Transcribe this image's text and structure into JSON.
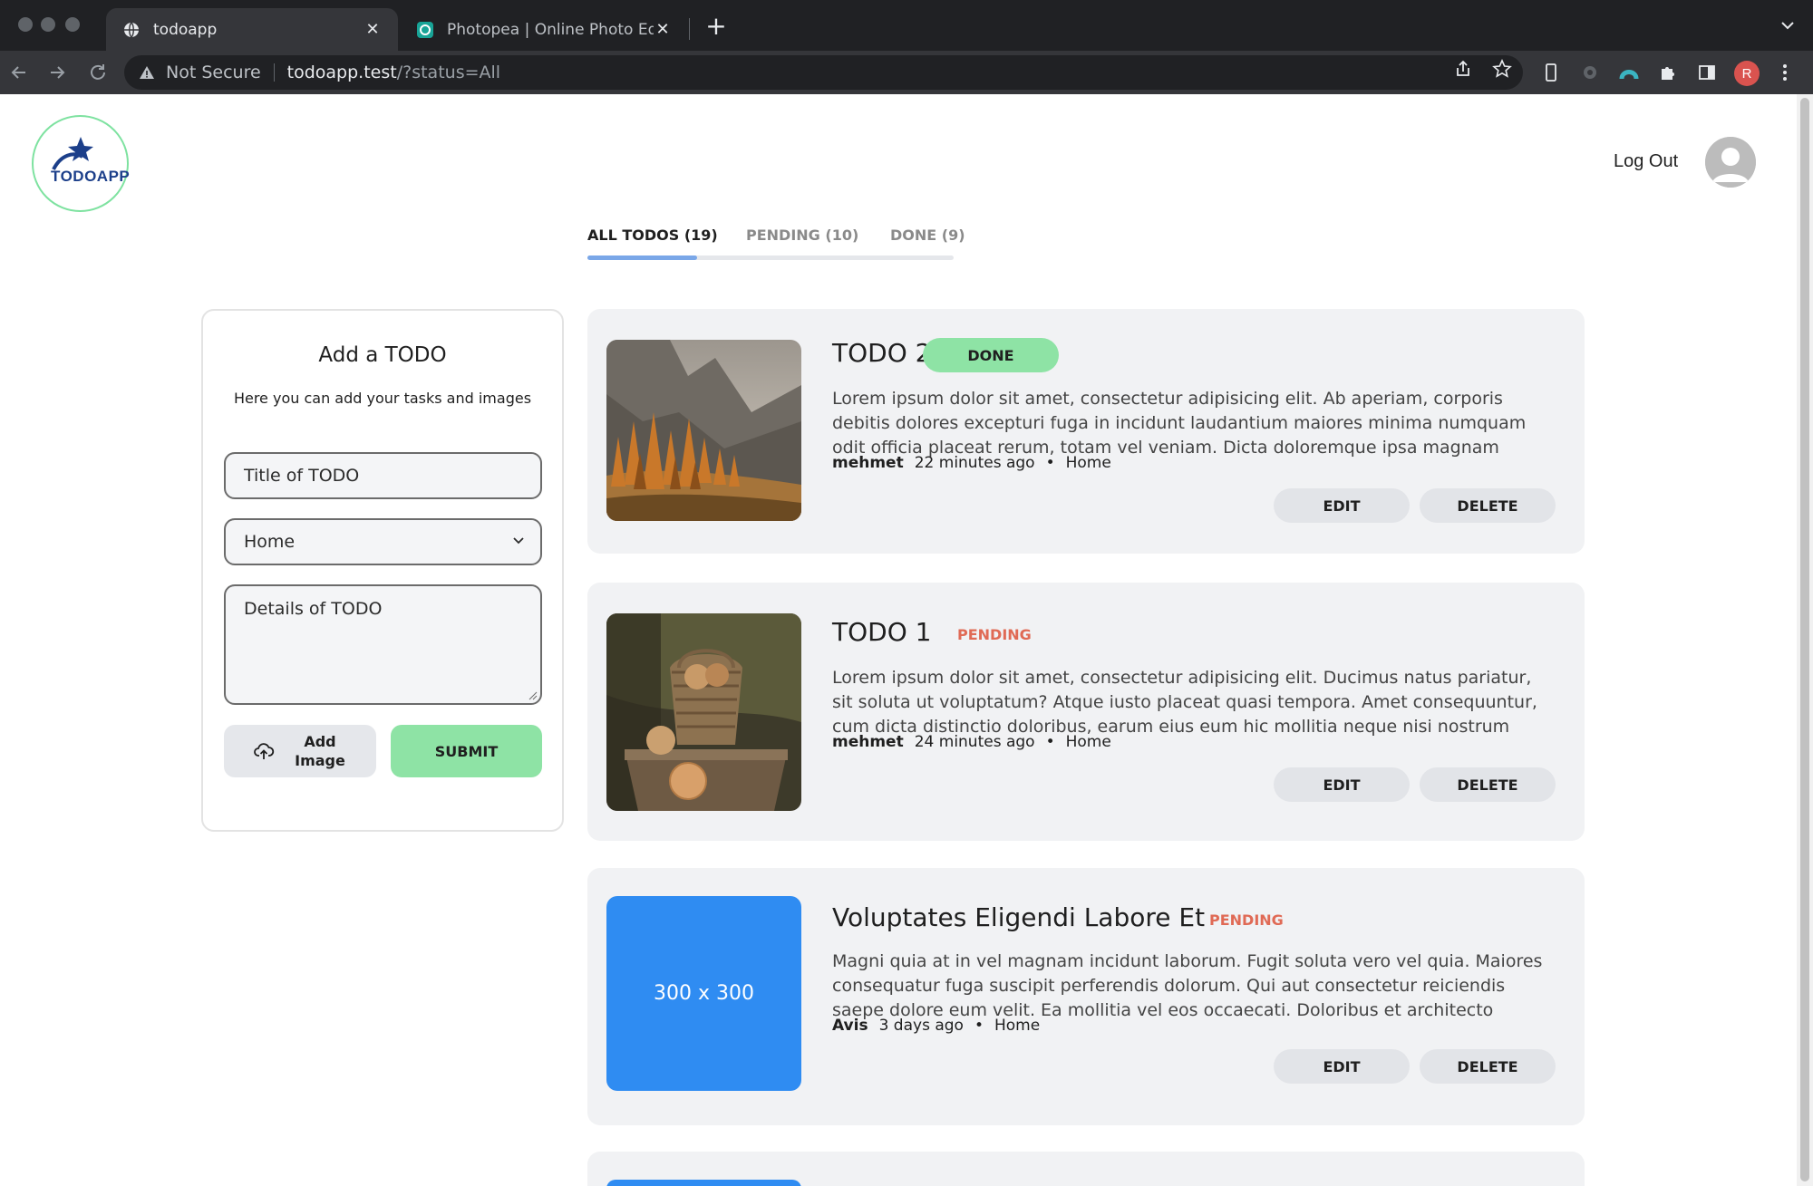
{
  "browser": {
    "tabs": [
      {
        "label": "todoapp",
        "active": true
      },
      {
        "label": "Photopea | Online Photo Editor",
        "active": false
      }
    ],
    "address": {
      "security": "Not Secure",
      "host": "todoapp.test",
      "path": "/?status=All"
    },
    "profile_initial": "R"
  },
  "header": {
    "logo_text": "TODOAPP",
    "logout_label": "Log Out"
  },
  "filter_tabs": [
    {
      "label": "ALL TODOS (19)",
      "active": true
    },
    {
      "label": "PENDING (10)",
      "active": false
    },
    {
      "label": "DONE (9)",
      "active": false
    }
  ],
  "add_form": {
    "title": "Add a TODO",
    "subtitle": "Here you can add your tasks and images",
    "title_placeholder": "Title of TODO",
    "category_value": "Home",
    "details_placeholder": "Details of TODO",
    "add_image_label": "Add Image",
    "submit_label": "SUBMIT"
  },
  "todos": [
    {
      "title": "TODO 2",
      "status": "DONE",
      "description": "Lorem ipsum dolor sit amet, consectetur adipisicing elit. Ab aperiam, corporis debitis dolores excepturi fuga in incidunt laudantium maiores minima numquam odit officia placeat rerum, totam vel veniam. Dicta doloremque ipsa magnam praesentium quo....",
      "author": "mehmet",
      "time": "22 minutes ago",
      "category": "Home",
      "image": "mountain-forest-photo"
    },
    {
      "title": "TODO 1",
      "status": "PENDING",
      "description": "Lorem ipsum dolor sit amet, consectetur adipisicing elit. Ducimus natus pariatur, sit soluta ut voluptatum? Atque iusto placeat quasi tempora. Amet consequuntur, cum dicta distinctio doloribus, earum eius eum hic mollitia neque nisi nostrum numquam officia...",
      "author": "mehmet",
      "time": "24 minutes ago",
      "category": "Home",
      "image": "onion-basket-photo"
    },
    {
      "title": "Voluptates Eligendi Labore Et",
      "status": "PENDING",
      "description": "Magni quia at in vel magnam incidunt laborum. Fugit soluta vero vel quia. Maiores consequatur fuga suscipit perferendis dolorum. Qui aut consectetur reiciendis saepe dolore eum velit. Ea mollitia vel eos occaecati. Doloribus et architecto tempora. Dolore...",
      "author": "Avis",
      "time": "3 days ago",
      "category": "Home",
      "image_placeholder": "300 x 300"
    }
  ],
  "card_actions": {
    "edit": "EDIT",
    "delete": "DELETE"
  },
  "colors": {
    "done_badge": "#8ee3a5",
    "pending_text": "#e06a55",
    "placeholder_blue": "#2f8cf2",
    "tab_indicator": "#7aa7e8"
  }
}
